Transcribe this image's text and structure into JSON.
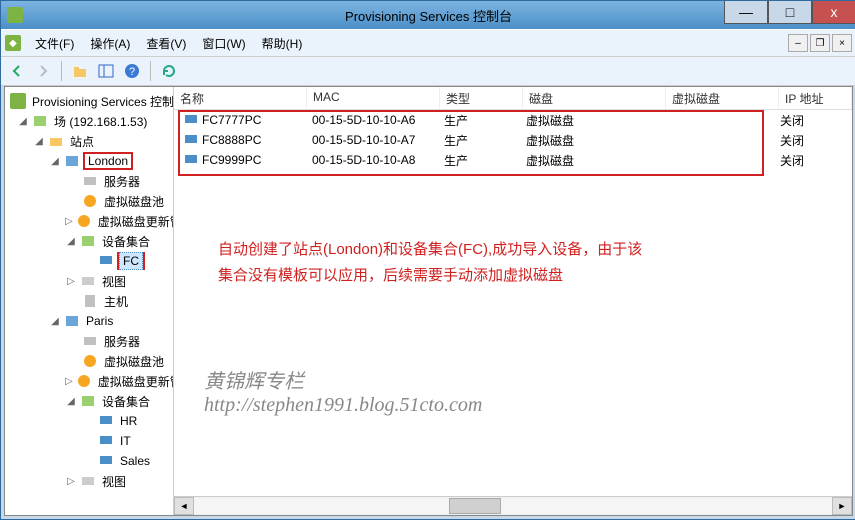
{
  "window": {
    "title": "Provisioning Services 控制台",
    "controls": {
      "min": "—",
      "max": "□",
      "close": "x"
    }
  },
  "menubar": {
    "items": [
      {
        "label": "文件(F)"
      },
      {
        "label": "操作(A)"
      },
      {
        "label": "查看(V)"
      },
      {
        "label": "窗口(W)"
      },
      {
        "label": "帮助(H)"
      }
    ],
    "mdi": {
      "min": "–",
      "restore": "❐",
      "close": "×"
    }
  },
  "tree": {
    "root": "Provisioning Services 控制台",
    "farm": "场 (192.168.1.53)",
    "sites": "站点",
    "london": "London",
    "london_children": {
      "servers": "服务器",
      "vdisk_pool": "虚拟磁盘池",
      "vdisk_update": "虚拟磁盘更新管理",
      "device_collections": "设备集合",
      "fc": "FC",
      "views": "视图",
      "hosts": "主机"
    },
    "paris": "Paris",
    "paris_children": {
      "servers": "服务器",
      "vdisk_pool": "虚拟磁盘池",
      "vdisk_update": "虚拟磁盘更新管理",
      "device_collections": "设备集合",
      "hr": "HR",
      "it": "IT",
      "sales": "Sales",
      "views": "视图"
    }
  },
  "list": {
    "columns": {
      "name": "名称",
      "mac": "MAC",
      "type": "类型",
      "disk": "磁盘",
      "vdisk": "虚拟磁盘",
      "ip": "IP 地址"
    },
    "rows": [
      {
        "name": "FC7777PC",
        "mac": "00-15-5D-10-10-A6",
        "type": "生产",
        "disk": "虚拟磁盘",
        "vdisk": "",
        "ip": "关闭"
      },
      {
        "name": "FC8888PC",
        "mac": "00-15-5D-10-10-A7",
        "type": "生产",
        "disk": "虚拟磁盘",
        "vdisk": "",
        "ip": "关闭"
      },
      {
        "name": "FC9999PC",
        "mac": "00-15-5D-10-10-A8",
        "type": "生产",
        "disk": "虚拟磁盘",
        "vdisk": "",
        "ip": "关闭"
      }
    ]
  },
  "annotation": {
    "line1": "自动创建了站点(London)和设备集合(FC),成功导入设备，由于该",
    "line2": "集合没有模板可以应用，后续需要手动添加虚拟磁盘"
  },
  "watermark": {
    "line1": "黄锦辉专栏",
    "line2": "http://stephen1991.blog.51cto.com"
  }
}
